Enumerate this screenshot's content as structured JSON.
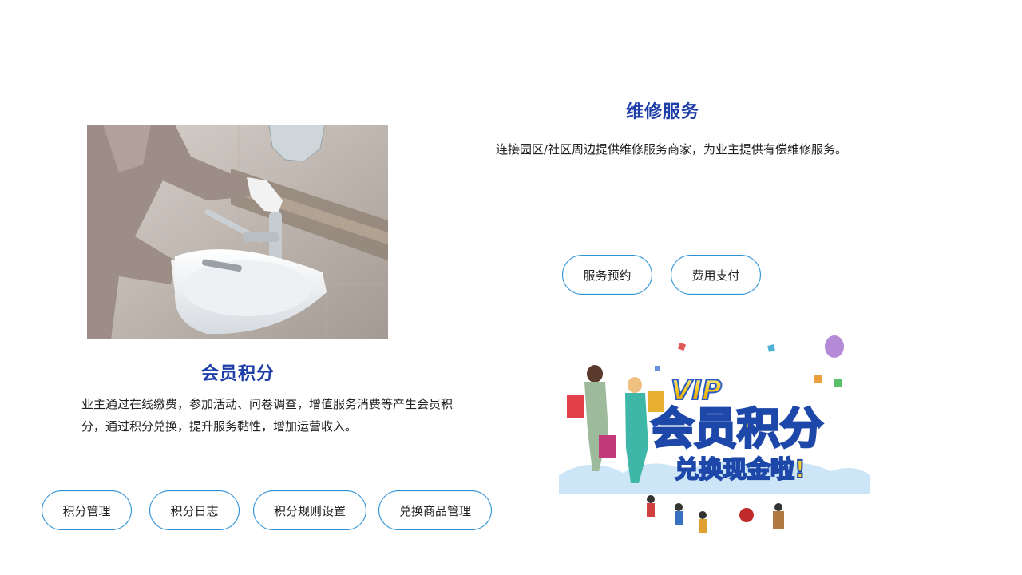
{
  "repair": {
    "title": "维修服务",
    "description": "连接园区/社区周边提供维修服务商家，为业主提供有偿维修服务。",
    "buttons": {
      "booking": "服务预约",
      "payment": "费用支付"
    }
  },
  "points": {
    "title": "会员积分",
    "description": "业主通过在线缴费，参加活动、问卷调查，增值服务消费等产生会员积分，通过积分兑换，提升服务黏性，增加运营收入。",
    "buttons": {
      "management": "积分管理",
      "log": "积分日志",
      "rules": "积分规则设置",
      "redeem": "兑换商品管理"
    }
  },
  "banner": {
    "vip": "VIP",
    "main": "会员积分",
    "sub": "兑换现金啦!"
  },
  "colors": {
    "title": "#1f3fa8",
    "pill_border": "#2f8fd5",
    "banner_gold": "#f5c518",
    "banner_blue": "#2a5cc4"
  }
}
